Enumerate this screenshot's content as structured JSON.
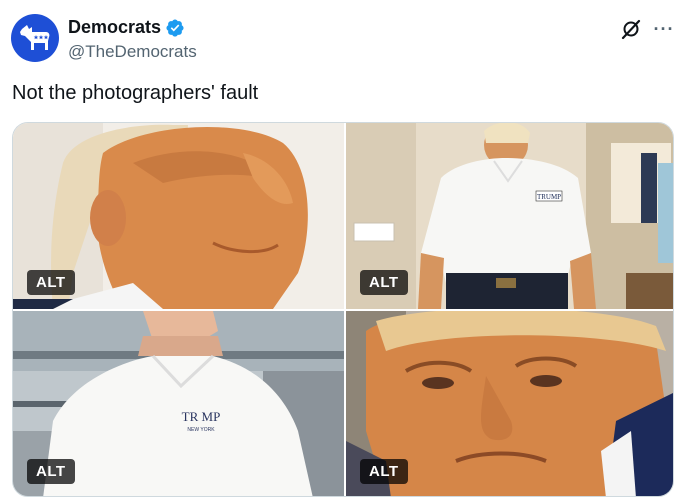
{
  "author": {
    "name": "Democrats",
    "handle": "@TheDemocrats",
    "verified": true,
    "avatar_icon": "donkey-logo-icon",
    "avatar_color": "#1e4fd6"
  },
  "actions": {
    "grok_icon": "grok-icon",
    "more_label": "···"
  },
  "tweet": {
    "text": "Not the photographers' fault"
  },
  "media": {
    "photos": [
      {
        "alt_label": "ALT"
      },
      {
        "alt_label": "ALT",
        "shirt_text": "TRUMP"
      },
      {
        "alt_label": "ALT",
        "shirt_text": "TR  MP",
        "shirt_subtext": "NEW YORK"
      },
      {
        "alt_label": "ALT"
      }
    ]
  },
  "colors": {
    "verified": "#1d9bf0",
    "handle": "#536471",
    "border": "#cfd9de"
  }
}
